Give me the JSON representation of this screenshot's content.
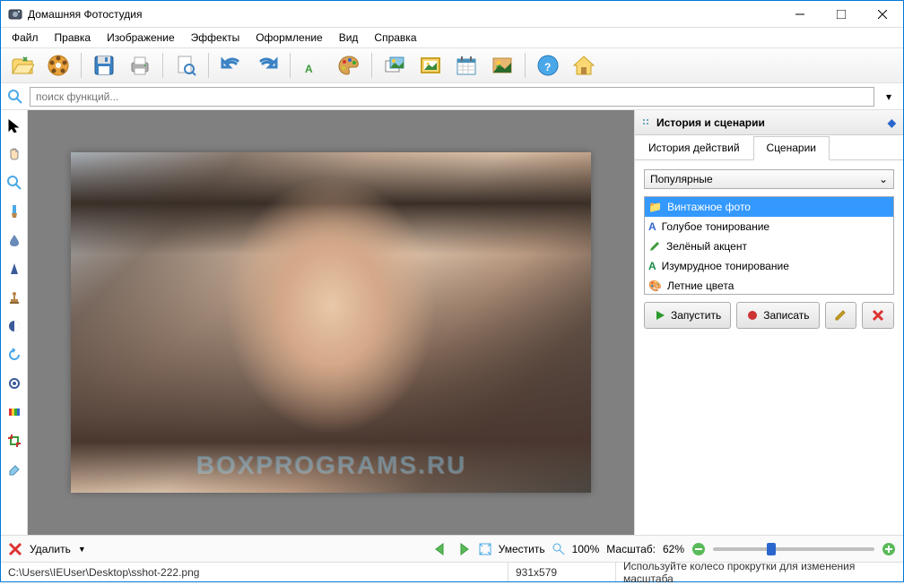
{
  "window": {
    "title": "Домашняя Фотостудия"
  },
  "menu": {
    "items": [
      "Файл",
      "Правка",
      "Изображение",
      "Эффекты",
      "Оформление",
      "Вид",
      "Справка"
    ]
  },
  "search": {
    "placeholder": "поиск функций..."
  },
  "rightpanel": {
    "title": "История и сценарии",
    "tabs": {
      "history": "История действий",
      "scenarios": "Сценарии"
    },
    "combo": "Популярные",
    "list": [
      "Винтажное фото",
      "Голубое тонирование",
      "Зелёный акцент",
      "Изумрудное тонирование",
      "Летние цвета"
    ],
    "buttons": {
      "run": "Запустить",
      "record": "Записать"
    }
  },
  "bottom": {
    "delete": "Удалить",
    "fit": "Уместить",
    "zoom100": "100%",
    "scale_label": "Масштаб:",
    "scale_value": "62%"
  },
  "status": {
    "path": "C:\\Users\\IEUser\\Desktop\\sshot-222.png",
    "dims": "931х579",
    "hint": "Используйте колесо прокрутки для изменения масштаба"
  },
  "watermark": "BOXPROGRAMS.RU"
}
